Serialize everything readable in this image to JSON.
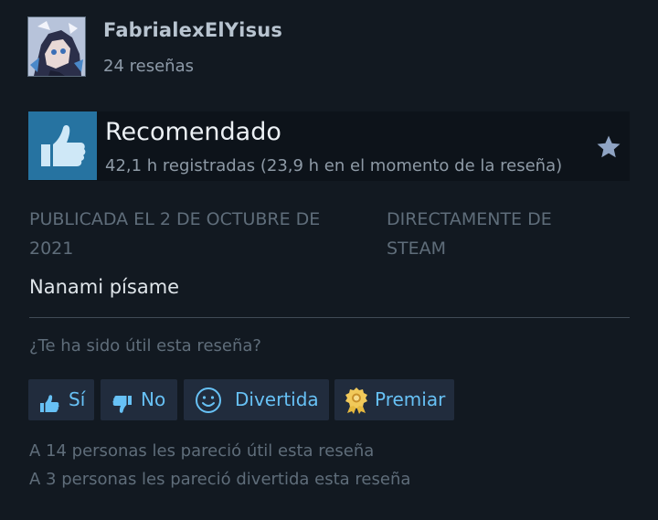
{
  "author": {
    "name": "FabrialexElYisus",
    "review_count": "24 reseñas",
    "avatar_icon": "anime-avatar-image"
  },
  "verdict": {
    "title": "Recomendado",
    "hours": "42,1 h registradas (23,9 h en el momento de la reseña)",
    "icon": "thumbs-up-icon",
    "accent": "#2673a1"
  },
  "meta": {
    "posted": "PUBLICADA EL 2 DE OCTUBRE DE 2021",
    "source": "DIRECTAMENTE DE STEAM"
  },
  "review": {
    "text": "Nanami písame"
  },
  "feedback": {
    "question": "¿Te ha sido útil esta reseña?",
    "buttons": {
      "yes": "Sí",
      "no": "No",
      "funny": "Divertida",
      "award": "Premiar"
    }
  },
  "stats": {
    "helpful": "A 14 personas les pareció útil esta reseña",
    "funny": "A 3 personas les pareció divertida esta reseña"
  },
  "colors": {
    "background": "#121921",
    "button_bg": "#212c3d",
    "button_text": "#67c1f5"
  }
}
